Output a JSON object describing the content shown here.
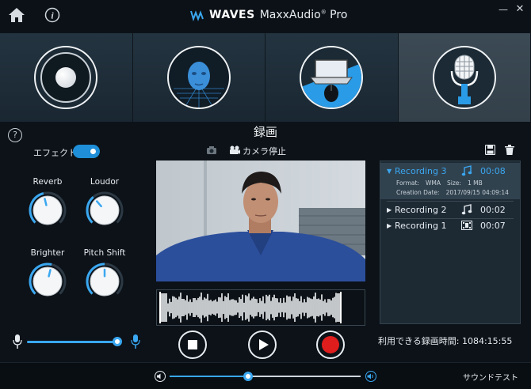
{
  "app": {
    "brand": "WAVES",
    "product": "MaxxAudio",
    "edition": "Pro",
    "registered": "®"
  },
  "tabs": [
    {
      "name": "speaker",
      "active": false
    },
    {
      "name": "head-3d",
      "active": false
    },
    {
      "name": "laptop",
      "active": false
    },
    {
      "name": "microphone",
      "active": true
    }
  ],
  "section_title": "録画",
  "help": "?",
  "effects": {
    "label": "エフェクト",
    "enabled": true,
    "knobs": [
      {
        "label": "Reverb",
        "level": 0.45
      },
      {
        "label": "Loudor",
        "level": 0.35
      },
      {
        "label": "Brighter",
        "level": 0.55
      },
      {
        "label": "Pitch Shift",
        "level": 0.5
      }
    ]
  },
  "camera": {
    "stop_label": "カメラ停止"
  },
  "recordings": [
    {
      "arrow": "▼",
      "name": "Recording 3",
      "type": "audio",
      "duration": "00:08",
      "format_label": "Format:",
      "format": "WMA",
      "size_label": "Size:",
      "size": "1 MB",
      "created_label": "Creation Date:",
      "created": "2017/09/15 04:09:14"
    },
    {
      "arrow": "▶",
      "name": "Recording 2",
      "type": "audio",
      "duration": "00:02"
    },
    {
      "arrow": "▶",
      "name": "Recording 1",
      "type": "video",
      "duration": "00:07"
    }
  ],
  "remaining": "利用できる録画時間: 1084:15:55",
  "mic_level": 0.95,
  "volume_level": 0.41,
  "sound_test": "サウンドテスト",
  "window": {
    "minimize": "—",
    "close": "✕"
  },
  "colors": {
    "accent": "#3aa7f0",
    "record": "#e01d1d",
    "background": "#0c1218"
  }
}
